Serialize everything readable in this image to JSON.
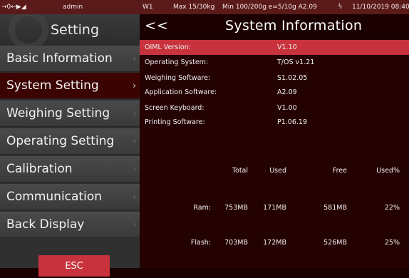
{
  "statusbar": {
    "icons": "→0←▶◢",
    "user": "admin",
    "scale": "W1",
    "max": "Max 15/30kg",
    "min": "Min 100/200g e=5/10g A2.09",
    "bolt": "ϟ",
    "date": "11/10/2019 08:40"
  },
  "sidebar": {
    "title": "Setting",
    "chevron": "›",
    "items": [
      {
        "label": "Basic Information"
      },
      {
        "label": "System Setting"
      },
      {
        "label": "Weighing Setting"
      },
      {
        "label": "Operating Setting"
      },
      {
        "label": "Calibration"
      },
      {
        "label": "Communication"
      },
      {
        "label": "Back Display"
      }
    ],
    "esc_label": "ESC"
  },
  "main": {
    "back_label": "<<",
    "title": "System Information",
    "info": [
      {
        "key": "OIML Version:",
        "value": "V1.10"
      },
      {
        "key": "Operating System:",
        "value": "T/OS v1.21"
      },
      {
        "key": "Weighing Software:",
        "value": "S1.02.05"
      },
      {
        "key": "Application Software:",
        "value": "A2.09"
      },
      {
        "key": "Screen Keyboard:",
        "value": "V1.00"
      },
      {
        "key": "Printing Software:",
        "value": "P1.06.19"
      }
    ],
    "memory": {
      "headers": [
        "Total",
        "Used",
        "Free",
        "Used%"
      ],
      "rows": [
        {
          "label": "Ram:",
          "total": "753MB",
          "used": "171MB",
          "free": "581MB",
          "pct": "22%"
        },
        {
          "label": "Flash:",
          "total": "703MB",
          "used": "172MB",
          "free": "526MB",
          "pct": "25%"
        }
      ]
    }
  },
  "colors": {
    "accent": "#c8323c",
    "active_menu": "#3c0303",
    "status_bar": "#5b1a1a",
    "main_bg": "#250202"
  }
}
